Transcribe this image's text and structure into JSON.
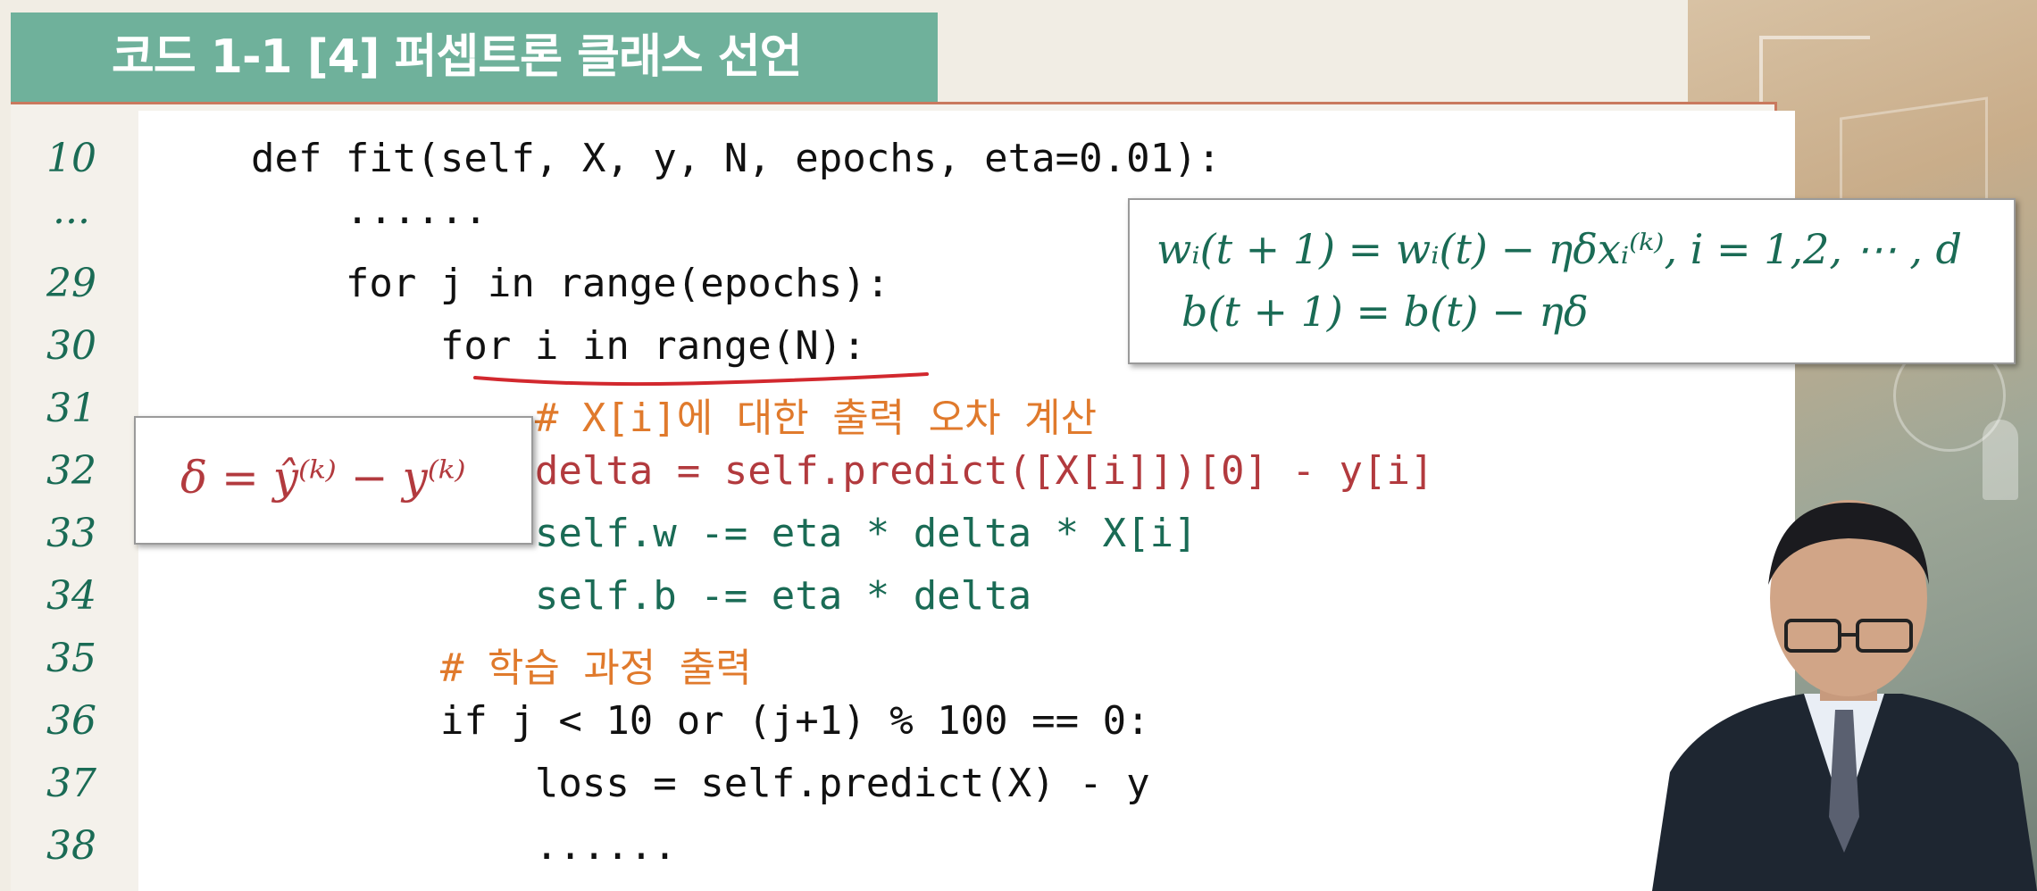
{
  "title": "코드 1-1 [4] 퍼셉트론 클래스 선언",
  "code_lines": [
    {
      "num": "10",
      "text": "    def fit(self, X, y, N, epochs, eta=0.01):"
    },
    {
      "num": "...",
      "text": "        ......"
    },
    {
      "num": "29",
      "text": "        for j in range(epochs):"
    },
    {
      "num": "30",
      "text": "            for i in range(N):"
    },
    {
      "num": "31",
      "text": "                # X[i]에 대한 출력 오차 계산"
    },
    {
      "num": "32",
      "text": "                delta = self.predict([X[i]])[0] - y[i]"
    },
    {
      "num": "33",
      "text": "                self.w -= eta * delta * X[i]"
    },
    {
      "num": "34",
      "text": "                self.b -= eta * delta"
    },
    {
      "num": "35",
      "text": "            # 학습 과정 출력"
    },
    {
      "num": "36",
      "text": "            if j < 10 or (j+1) % 100 == 0:"
    },
    {
      "num": "37",
      "text": "                loss = self.predict(X) - y"
    },
    {
      "num": "38",
      "text": "                ......"
    }
  ],
  "formulas": {
    "weight_update": "wᵢ(t + 1) = wᵢ(t) − ηδxᵢ⁽ᵏ⁾, i = 1,2, ⋯ , d",
    "bias_update": "b(t + 1) = b(t) − ηδ",
    "delta": "δ = ŷ⁽ᵏ⁾ − y⁽ᵏ⁾"
  },
  "colors": {
    "title_bg": "#6fb19b",
    "comment": "#e07a2c",
    "delta_line": "#b23a3e",
    "update_line": "#1a6b55",
    "line_number": "#1a6b55"
  }
}
